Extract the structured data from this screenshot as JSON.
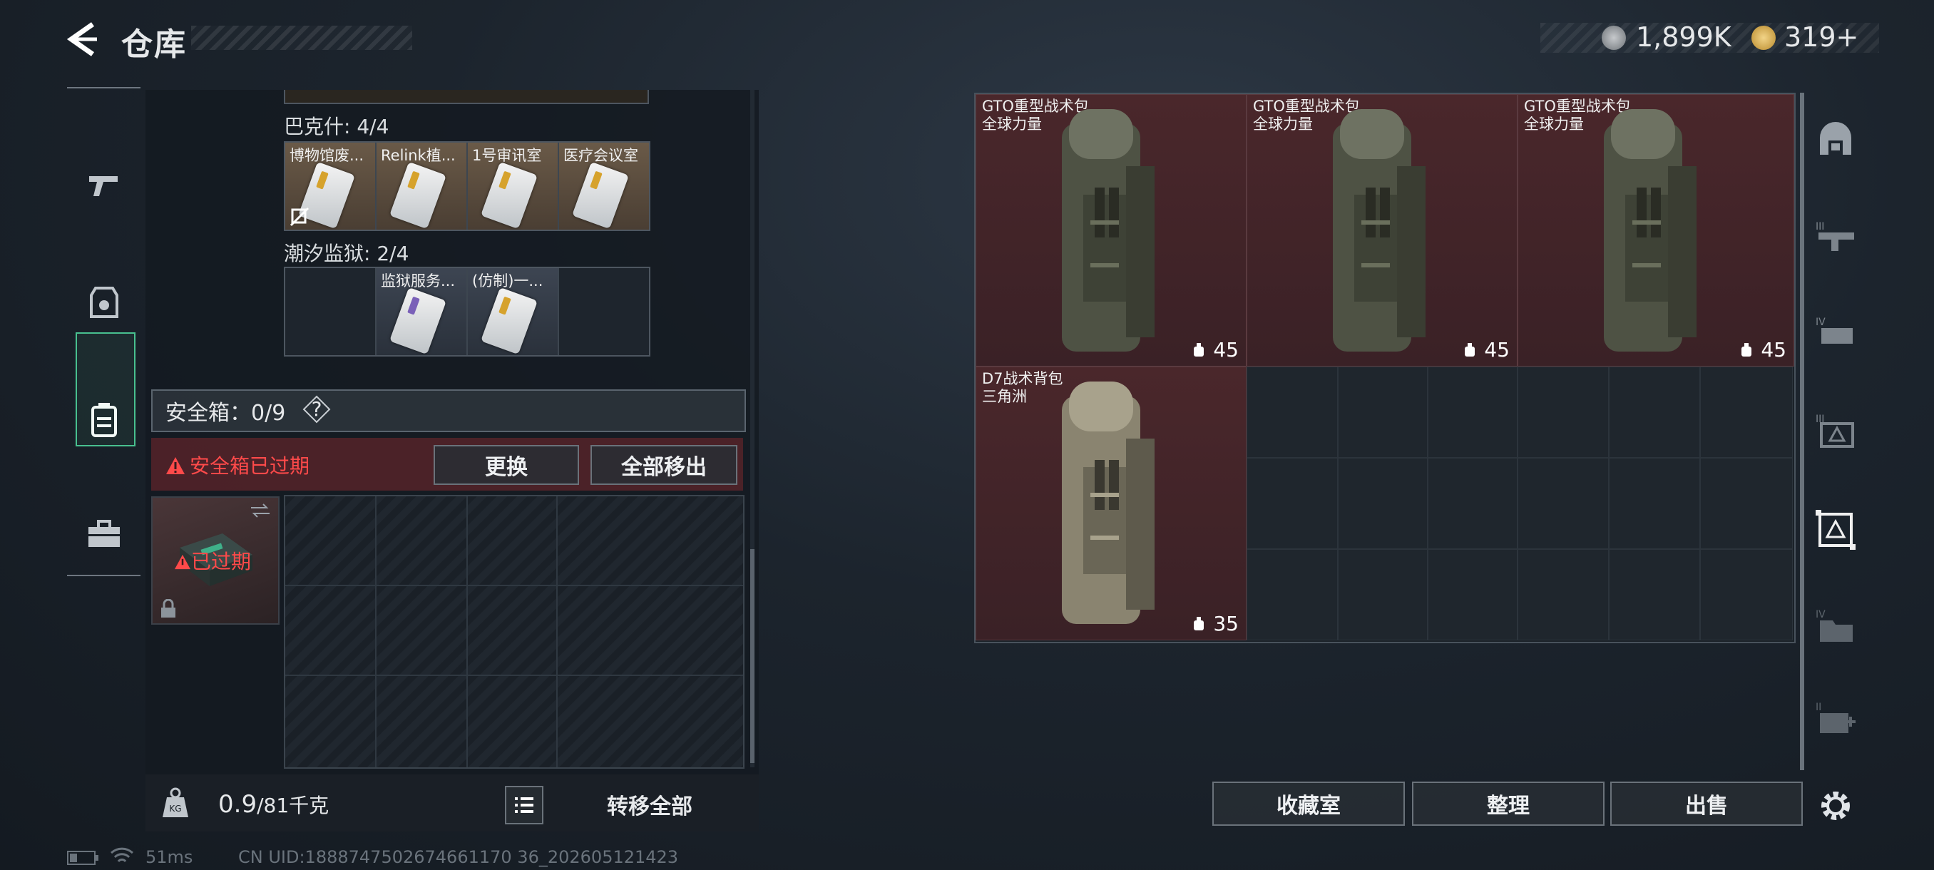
{
  "header": {
    "title": "仓库"
  },
  "currency": {
    "silver": "1,899K",
    "gold": "319+"
  },
  "left_nav": [
    {
      "name": "gun-icon",
      "label": "枪械"
    },
    {
      "name": "armor-icon",
      "label": "防具"
    },
    {
      "name": "backpack-icon",
      "label": "背包"
    },
    {
      "name": "toolbox-icon",
      "label": "工具"
    }
  ],
  "groups": [
    {
      "label": "巴克什: 4/4",
      "style": "warm",
      "cells": [
        "博物馆废...",
        "Relink植...",
        "1号审讯室",
        "医疗会议室"
      ]
    },
    {
      "label": "潮汐监狱: 2/4",
      "style": "cool",
      "cells": [
        "",
        "监狱服务...",
        "(仿制)一...",
        ""
      ]
    }
  ],
  "safe_box": {
    "title": "安全箱：0/9",
    "help": "?",
    "warning": "安全箱已过期",
    "replace_btn": "更换",
    "remove_all_btn": "全部移出",
    "expired_label": "已过期"
  },
  "footer_left": {
    "weight_current": "0.9",
    "weight_capacity": "/81千克",
    "transfer_all": "转移全部"
  },
  "status_bar": {
    "ping": "51ms",
    "uid": "CN UID:1888747502674661170 36_202605121423"
  },
  "bags": [
    {
      "name": "GTO重型战术包",
      "sub": "全球力量",
      "count": "45"
    },
    {
      "name": "GTO重型战术包",
      "sub": "全球力量",
      "count": "45"
    },
    {
      "name": "GTO重型战术包",
      "sub": "全球力量",
      "count": "45"
    },
    {
      "name": "D7战术背包",
      "sub": "三角洲",
      "count": "35"
    }
  ],
  "right_buttons": {
    "collection": "收藏室",
    "organize": "整理",
    "sell": "出售"
  },
  "side_icons": [
    "hideout-icon",
    "tier3-weapon-icon",
    "tier4-weapon-icon",
    "tier3-armor-icon",
    "tier-armor-icon",
    "tier4-folder-icon",
    "tier2-medkit-icon",
    "settings-icon"
  ],
  "colors": {
    "accent": "#48c08f",
    "warning": "#ff4a4a",
    "bag_bg": "#4a272b"
  }
}
